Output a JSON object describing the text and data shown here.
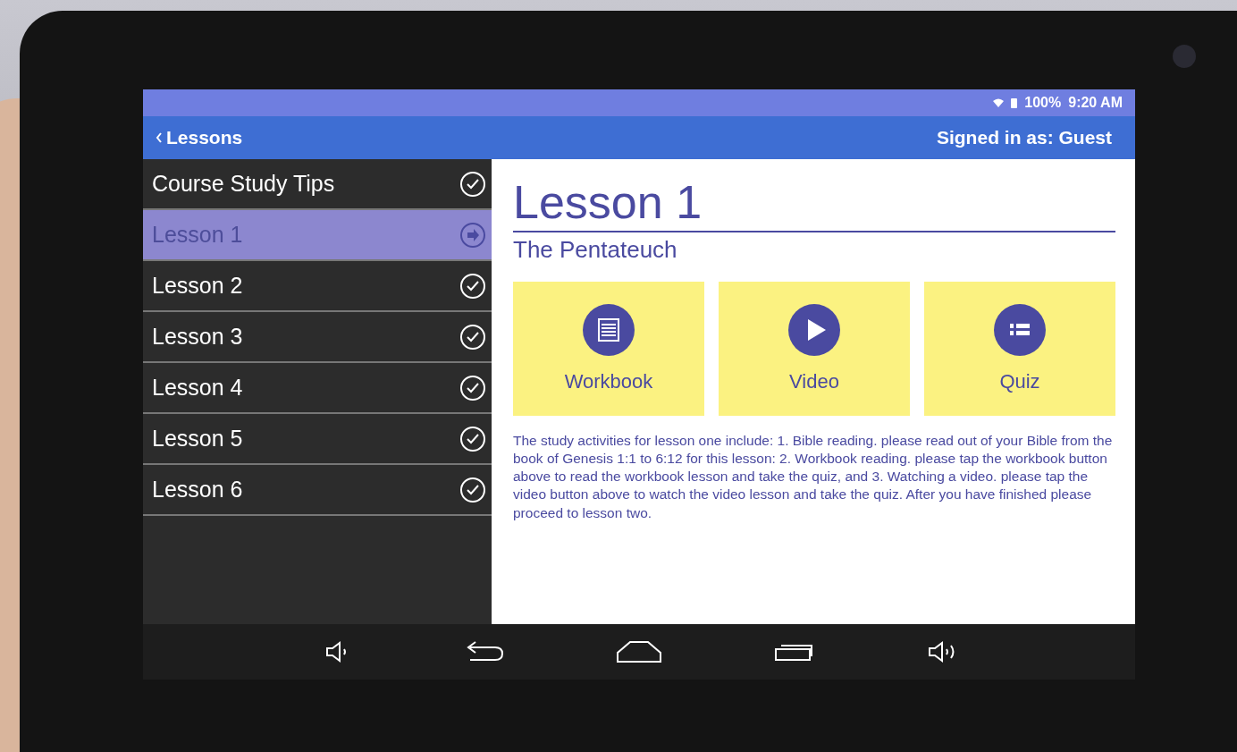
{
  "status_bar": {
    "battery": "100%",
    "time": "9:20 AM"
  },
  "header": {
    "back_label": "Lessons",
    "signed_in": "Signed in as: Guest"
  },
  "sidebar": {
    "items": [
      {
        "label": "Course Study Tips",
        "selected": false
      },
      {
        "label": "Lesson 1",
        "selected": true
      },
      {
        "label": "Lesson 2",
        "selected": false
      },
      {
        "label": "Lesson 3",
        "selected": false
      },
      {
        "label": "Lesson 4",
        "selected": false
      },
      {
        "label": "Lesson 5",
        "selected": false
      },
      {
        "label": "Lesson 6",
        "selected": false
      }
    ]
  },
  "content": {
    "title": "Lesson 1",
    "subtitle": "The Pentateuch",
    "tiles": [
      {
        "kind": "workbook",
        "label": "Workbook"
      },
      {
        "kind": "video",
        "label": "Video"
      },
      {
        "kind": "quiz",
        "label": "Quiz"
      }
    ],
    "description": "The study activities for lesson one include: 1. Bible reading. please read out of your Bible from the book of Genesis 1:1 to 6:12 for this lesson: 2. Workbook reading. please tap the workbook button above to read the workbook lesson and take the quiz, and 3. Watching a video. please tap the video button above to watch the video lesson and take the quiz. After you have finished please proceed to lesson two."
  }
}
